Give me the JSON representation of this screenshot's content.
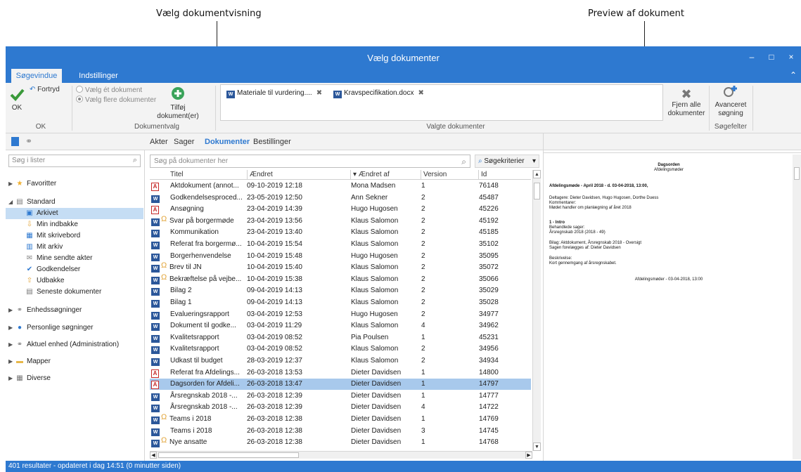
{
  "annotations": {
    "left": "Vælg dokumentvisning",
    "right": "Preview af dokument"
  },
  "window": {
    "title": "Vælg dokumenter",
    "minimize": "–",
    "maximize": "□",
    "close": "×"
  },
  "ribbon_tabs": [
    "Søgevindue",
    "Indstillinger"
  ],
  "ribbon": {
    "ok_label": "OK",
    "undo_label": "Fortryd",
    "group_ok": "OK",
    "radio_single": "Vælg ét dokument",
    "radio_multiple": "Vælg flere dokumenter",
    "add_label_1": "Tilføj",
    "add_label_2": "dokument(er)",
    "group_docselect": "Dokumentvalg",
    "selected_docs": [
      "Materiale til vurdering....",
      "Kravspecifikation.docx"
    ],
    "group_selected": "Valgte dokumenter",
    "remove_all_1": "Fjern alle",
    "remove_all_2": "dokumenter",
    "advanced_1": "Avanceret",
    "advanced_2": "søgning",
    "group_searchfields": "Søgefelter"
  },
  "left_panel": {
    "search_placeholder": "Søg i lister",
    "tree": [
      {
        "label": "Favoritter",
        "icon": "star-icon",
        "arrow": "▶",
        "level": 0
      },
      {
        "label": "Standard",
        "icon": "list-icon",
        "arrow": "◢",
        "level": 0
      },
      {
        "label": "Arkivet",
        "icon": "archive-icon",
        "arrow": "",
        "level": 1,
        "selected": true
      },
      {
        "label": "Min indbakke",
        "icon": "inbox-icon",
        "arrow": "",
        "level": 1
      },
      {
        "label": "Mit skrivebord",
        "icon": "desk-icon",
        "arrow": "",
        "level": 1
      },
      {
        "label": "Mit arkiv",
        "icon": "my-archive-icon",
        "arrow": "",
        "level": 1
      },
      {
        "label": "Mine sendte akter",
        "icon": "sent-icon",
        "arrow": "",
        "level": 1
      },
      {
        "label": "Godkendelser",
        "icon": "approval-icon",
        "arrow": "",
        "level": 1
      },
      {
        "label": "Udbakke",
        "icon": "outbox-icon",
        "arrow": "",
        "level": 1
      },
      {
        "label": "Seneste dokumenter",
        "icon": "recent-icon",
        "arrow": "",
        "level": 1
      },
      {
        "label": "Enhedssøgninger",
        "icon": "unit-search-icon",
        "arrow": "▶",
        "level": 0
      },
      {
        "label": "Personlige søgninger",
        "icon": "person-icon",
        "arrow": "▶",
        "level": 0
      },
      {
        "label": "Aktuel enhed (Administration)",
        "icon": "unit-icon",
        "arrow": "▶",
        "level": 0
      },
      {
        "label": "Mapper",
        "icon": "folder-icon",
        "arrow": "▶",
        "level": 0
      },
      {
        "label": "Diverse",
        "icon": "misc-icon",
        "arrow": "▶",
        "level": 0
      }
    ]
  },
  "center": {
    "tabs": [
      "Akter",
      "Sager",
      "Dokumenter",
      "Bestillinger"
    ],
    "active_tab": "Dokumenter",
    "search_placeholder": "Søg på dokumenter her",
    "criteria_label": "Søgekriterier",
    "columns": [
      "Titel",
      "Ændret",
      "Ændret af",
      "Version",
      "Id"
    ],
    "rows": [
      {
        "type": "pdf",
        "lock": false,
        "title": "Aktdokument (annot...",
        "changed": "09-10-2019 12:18",
        "by": "Mona Madsen",
        "version": "1",
        "id": "76148"
      },
      {
        "type": "word",
        "lock": false,
        "title": "Godkendelsesproced...",
        "changed": "23-05-2019 12:50",
        "by": "Ann Sekner",
        "version": "2",
        "id": "45487"
      },
      {
        "type": "pdf",
        "lock": false,
        "title": "Ansøgning",
        "changed": "23-04-2019 14:39",
        "by": "Hugo Hugosen",
        "version": "2",
        "id": "45226"
      },
      {
        "type": "word",
        "lock": true,
        "title": "Svar på borgermøde",
        "changed": "23-04-2019 13:56",
        "by": "Klaus Salomon",
        "version": "2",
        "id": "45192"
      },
      {
        "type": "word",
        "lock": false,
        "title": "Kommunikation",
        "changed": "23-04-2019 13:40",
        "by": "Klaus Salomon",
        "version": "2",
        "id": "45185"
      },
      {
        "type": "word",
        "lock": false,
        "title": "Referat fra borgermø...",
        "changed": "10-04-2019 15:54",
        "by": "Klaus Salomon",
        "version": "2",
        "id": "35102"
      },
      {
        "type": "word",
        "lock": false,
        "title": "Borgerhenvendelse",
        "changed": "10-04-2019 15:48",
        "by": "Hugo Hugosen",
        "version": "2",
        "id": "35095"
      },
      {
        "type": "word",
        "lock": true,
        "title": "Brev til JN",
        "changed": "10-04-2019 15:40",
        "by": "Klaus Salomon",
        "version": "2",
        "id": "35072"
      },
      {
        "type": "word",
        "lock": true,
        "title": "Bekræftelse på vejbe...",
        "changed": "10-04-2019 15:38",
        "by": "Klaus Salomon",
        "version": "2",
        "id": "35066"
      },
      {
        "type": "word",
        "lock": false,
        "title": "Bilag 2",
        "changed": "09-04-2019 14:13",
        "by": "Klaus Salomon",
        "version": "2",
        "id": "35029"
      },
      {
        "type": "word",
        "lock": false,
        "title": "Bilag 1",
        "changed": "09-04-2019 14:13",
        "by": "Klaus Salomon",
        "version": "2",
        "id": "35028"
      },
      {
        "type": "word",
        "lock": false,
        "title": "Evalueringsrapport",
        "changed": "03-04-2019 12:53",
        "by": "Hugo Hugosen",
        "version": "2",
        "id": "34977"
      },
      {
        "type": "word",
        "lock": false,
        "title": "Dokument til godke...",
        "changed": "03-04-2019 11:29",
        "by": "Klaus Salomon",
        "version": "4",
        "id": "34962"
      },
      {
        "type": "word",
        "lock": false,
        "title": "Kvalitetsrapport",
        "changed": "03-04-2019 08:52",
        "by": "Pia Poulsen",
        "version": "1",
        "id": "45231"
      },
      {
        "type": "word",
        "lock": false,
        "title": "Kvalitetsrapport",
        "changed": "03-04-2019 08:52",
        "by": "Klaus Salomon",
        "version": "2",
        "id": "34956"
      },
      {
        "type": "word",
        "lock": false,
        "title": "Udkast til budget",
        "changed": "28-03-2019 12:37",
        "by": "Klaus Salomon",
        "version": "2",
        "id": "34934"
      },
      {
        "type": "pdf",
        "lock": false,
        "title": "Referat fra Afdelings...",
        "changed": "26-03-2018 13:53",
        "by": "Dieter Davidsen",
        "version": "1",
        "id": "14800"
      },
      {
        "type": "pdf",
        "lock": false,
        "title": "Dagsorden for Afdeli...",
        "changed": "26-03-2018 13:47",
        "by": "Dieter Davidsen",
        "version": "1",
        "id": "14797",
        "selected": true
      },
      {
        "type": "word",
        "lock": false,
        "title": "Årsregnskab 2018 -...",
        "changed": "26-03-2018 12:39",
        "by": "Dieter Davidsen",
        "version": "1",
        "id": "14777"
      },
      {
        "type": "word",
        "lock": false,
        "title": "Årsregnskab 2018 -...",
        "changed": "26-03-2018 12:39",
        "by": "Dieter Davidsen",
        "version": "4",
        "id": "14722"
      },
      {
        "type": "word",
        "lock": true,
        "title": "Teams i 2018",
        "changed": "26-03-2018 12:38",
        "by": "Dieter Davidsen",
        "version": "1",
        "id": "14769"
      },
      {
        "type": "word",
        "lock": false,
        "title": "Teams i 2018",
        "changed": "26-03-2018 12:38",
        "by": "Dieter Davidsen",
        "version": "3",
        "id": "14745"
      },
      {
        "type": "word",
        "lock": true,
        "title": "Nye ansatte",
        "changed": "26-03-2018 12:38",
        "by": "Dieter Davidsen",
        "version": "1",
        "id": "14768"
      }
    ]
  },
  "preview": {
    "title": "Dagsorden",
    "subtitle": "Afdelingsmøder",
    "heading": "Afdelingsmøde - April 2018 - d. 03-04-2018, 13:00,",
    "participants": "Deltagere: Dieter Davidsen, Hugo Hugosen, Dorthe Duess",
    "comments_label": "Kommentarer:",
    "comments": "Mødet handler om planlægning af året 2018",
    "item": "1 - Intro",
    "cases_label": "Behandlede sager:",
    "cases": "Årsregnskab 2018 (2018 - 49)",
    "attachment": "Bilag: Aktdokument, Årsregnskab 2018 - Oversigt",
    "presented": "Sagen forelægges af: Dieter Davidsen",
    "desc_label": "Beskrivelse:",
    "desc": "Kort gennemgang af årsregnskabet.",
    "footer": "Afdelingsmøder - 03-04-2018, 13:00"
  },
  "status": "401 resultater - opdateret i dag 14:51 (0 minutter siden)",
  "colors": {
    "accent": "#2e79d0",
    "selection": "#a8c9ec",
    "pdf_red": "#c62828",
    "word_blue": "#2b579a",
    "lock_gold": "#e2a53b"
  }
}
